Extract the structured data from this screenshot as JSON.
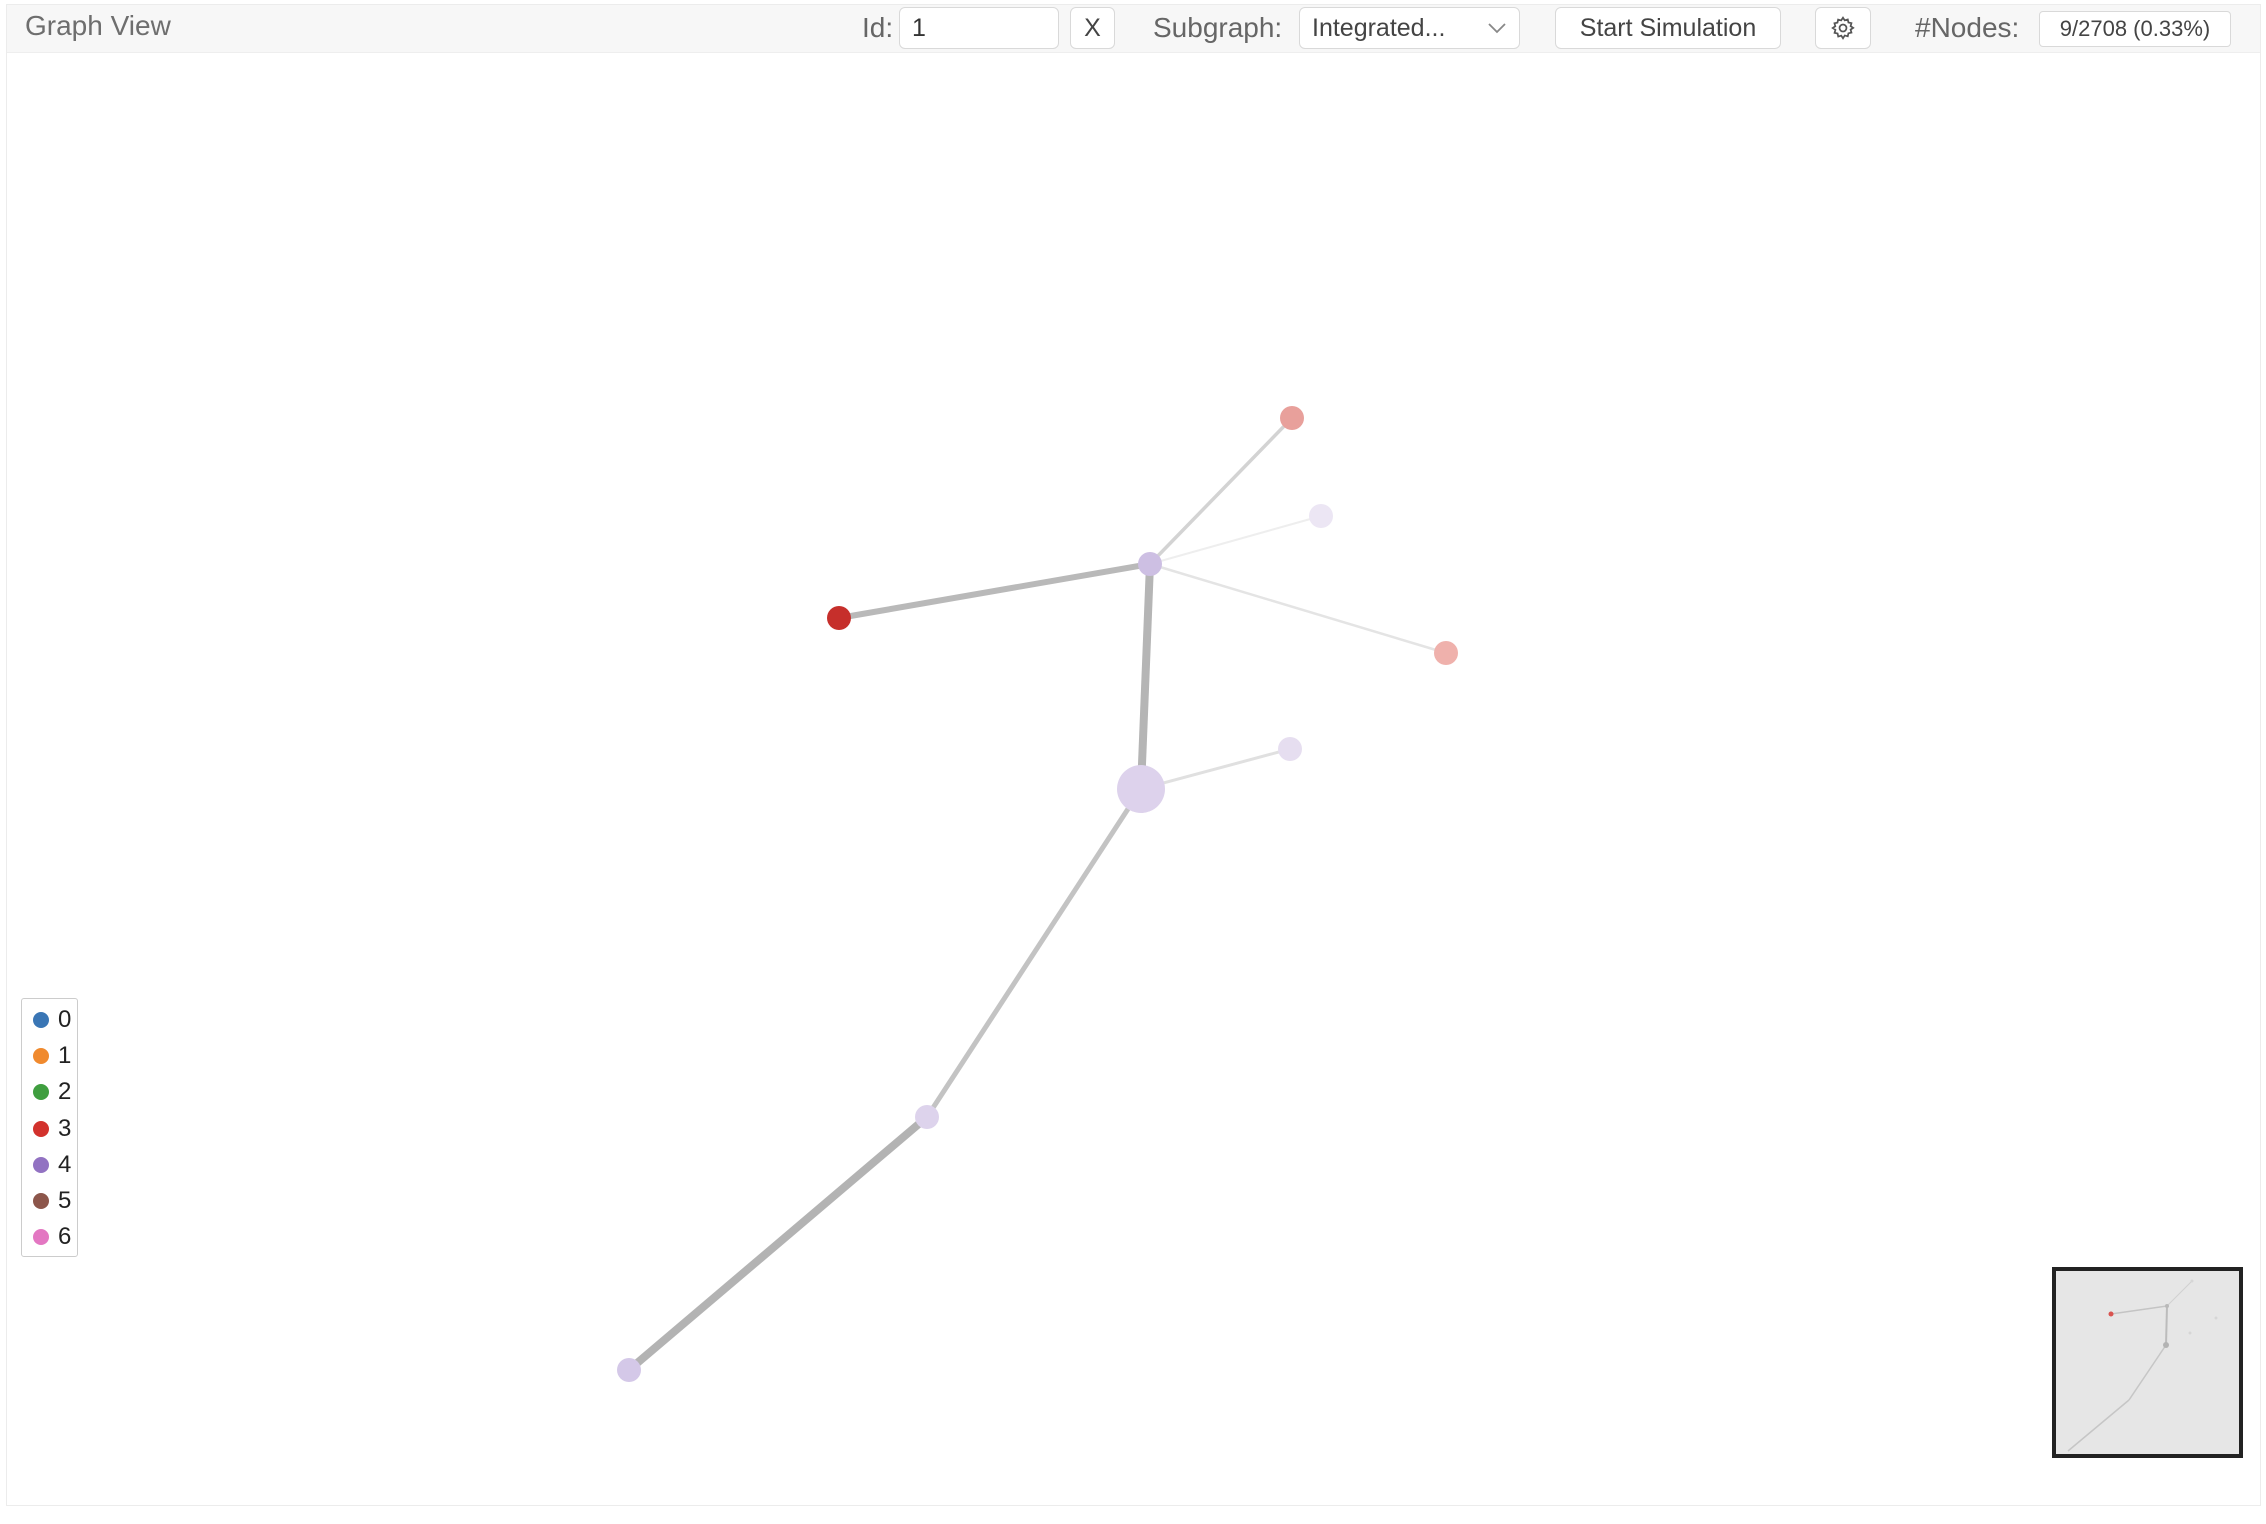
{
  "toolbar": {
    "title": "Graph View",
    "id_label": "Id:",
    "id_value": "1",
    "clear_label": "X",
    "subgraph_label": "Subgraph:",
    "subgraph_value": "Integrated...",
    "start_label": "Start Simulation",
    "nodes_label": "#Nodes:",
    "nodes_value": "9/2708 (0.33%)"
  },
  "legend": {
    "items": [
      {
        "label": "0",
        "color": "#3a76b5"
      },
      {
        "label": "1",
        "color": "#f08a2e"
      },
      {
        "label": "2",
        "color": "#3f9e3f"
      },
      {
        "label": "3",
        "color": "#d2322d"
      },
      {
        "label": "4",
        "color": "#9272c2"
      },
      {
        "label": "5",
        "color": "#8c564b"
      },
      {
        "label": "6",
        "color": "#e377c2"
      }
    ]
  },
  "icons": {
    "settings": "gear-icon",
    "dropdown": "chevron-down-icon"
  }
}
